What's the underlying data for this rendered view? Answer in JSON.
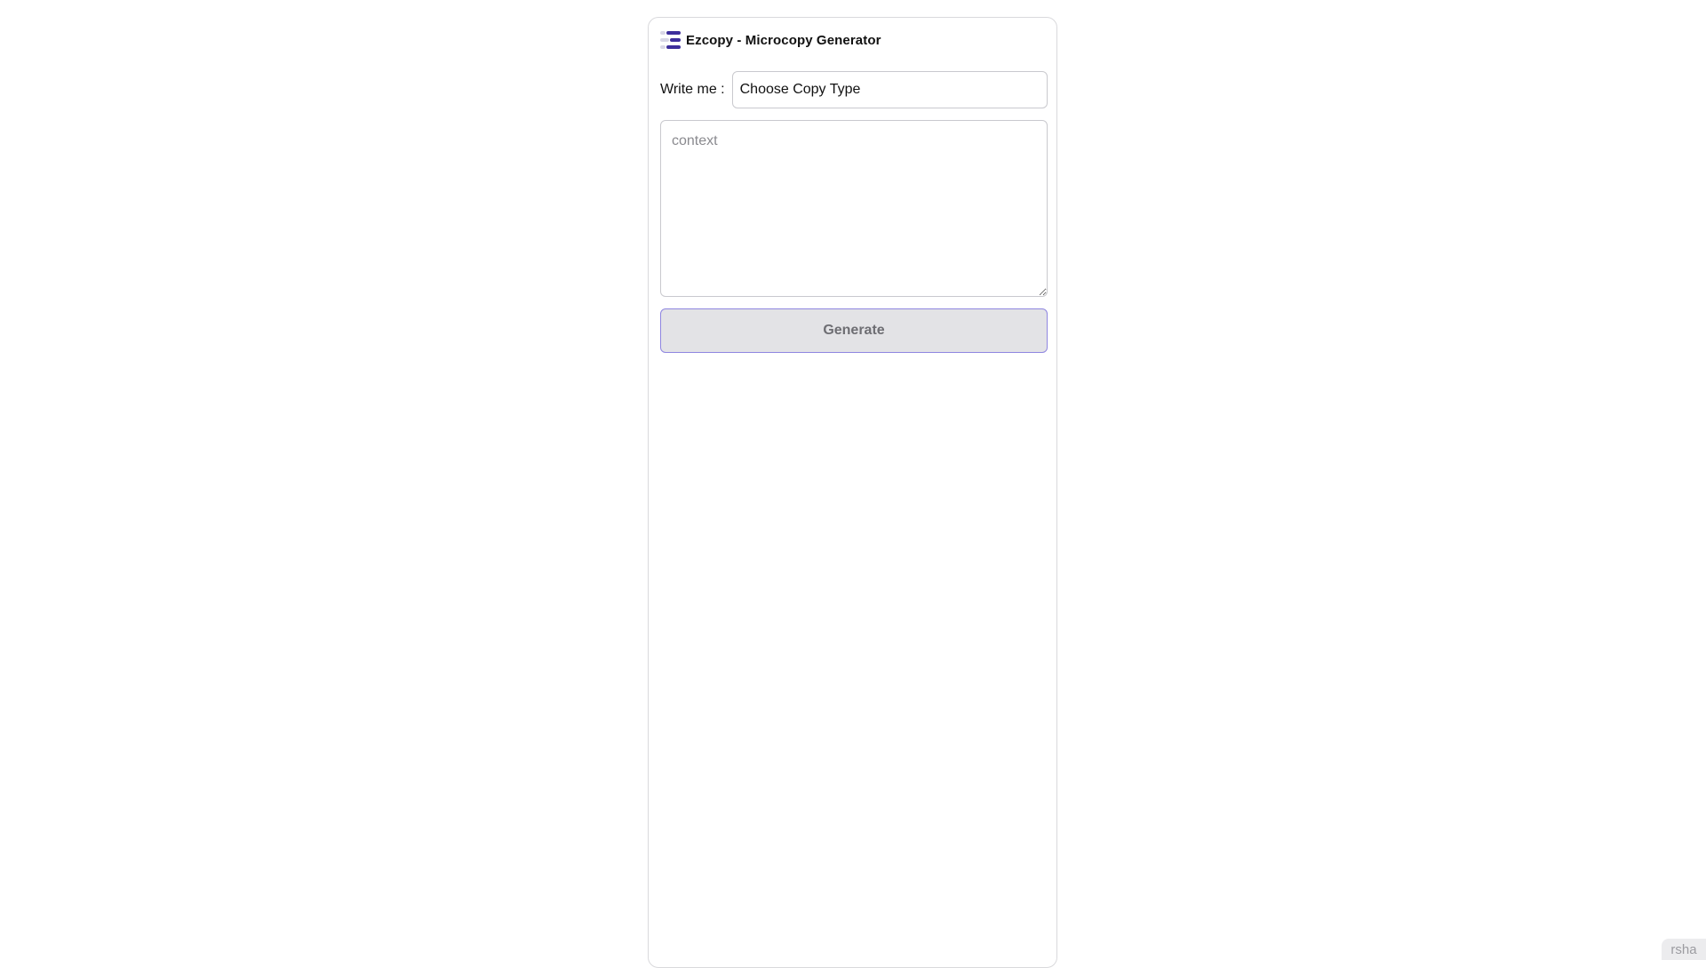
{
  "app": {
    "title": "Ezcopy - Microcopy Generator",
    "logo_icon": "stacked-bars-logo-icon",
    "brand_color": "#3d2e9c"
  },
  "form": {
    "write_label": "Write me :",
    "copy_type_value": "Choose Copy Type",
    "context_placeholder": "context",
    "generate_label": "Generate"
  },
  "footer": {
    "corner_text": "rsha"
  }
}
